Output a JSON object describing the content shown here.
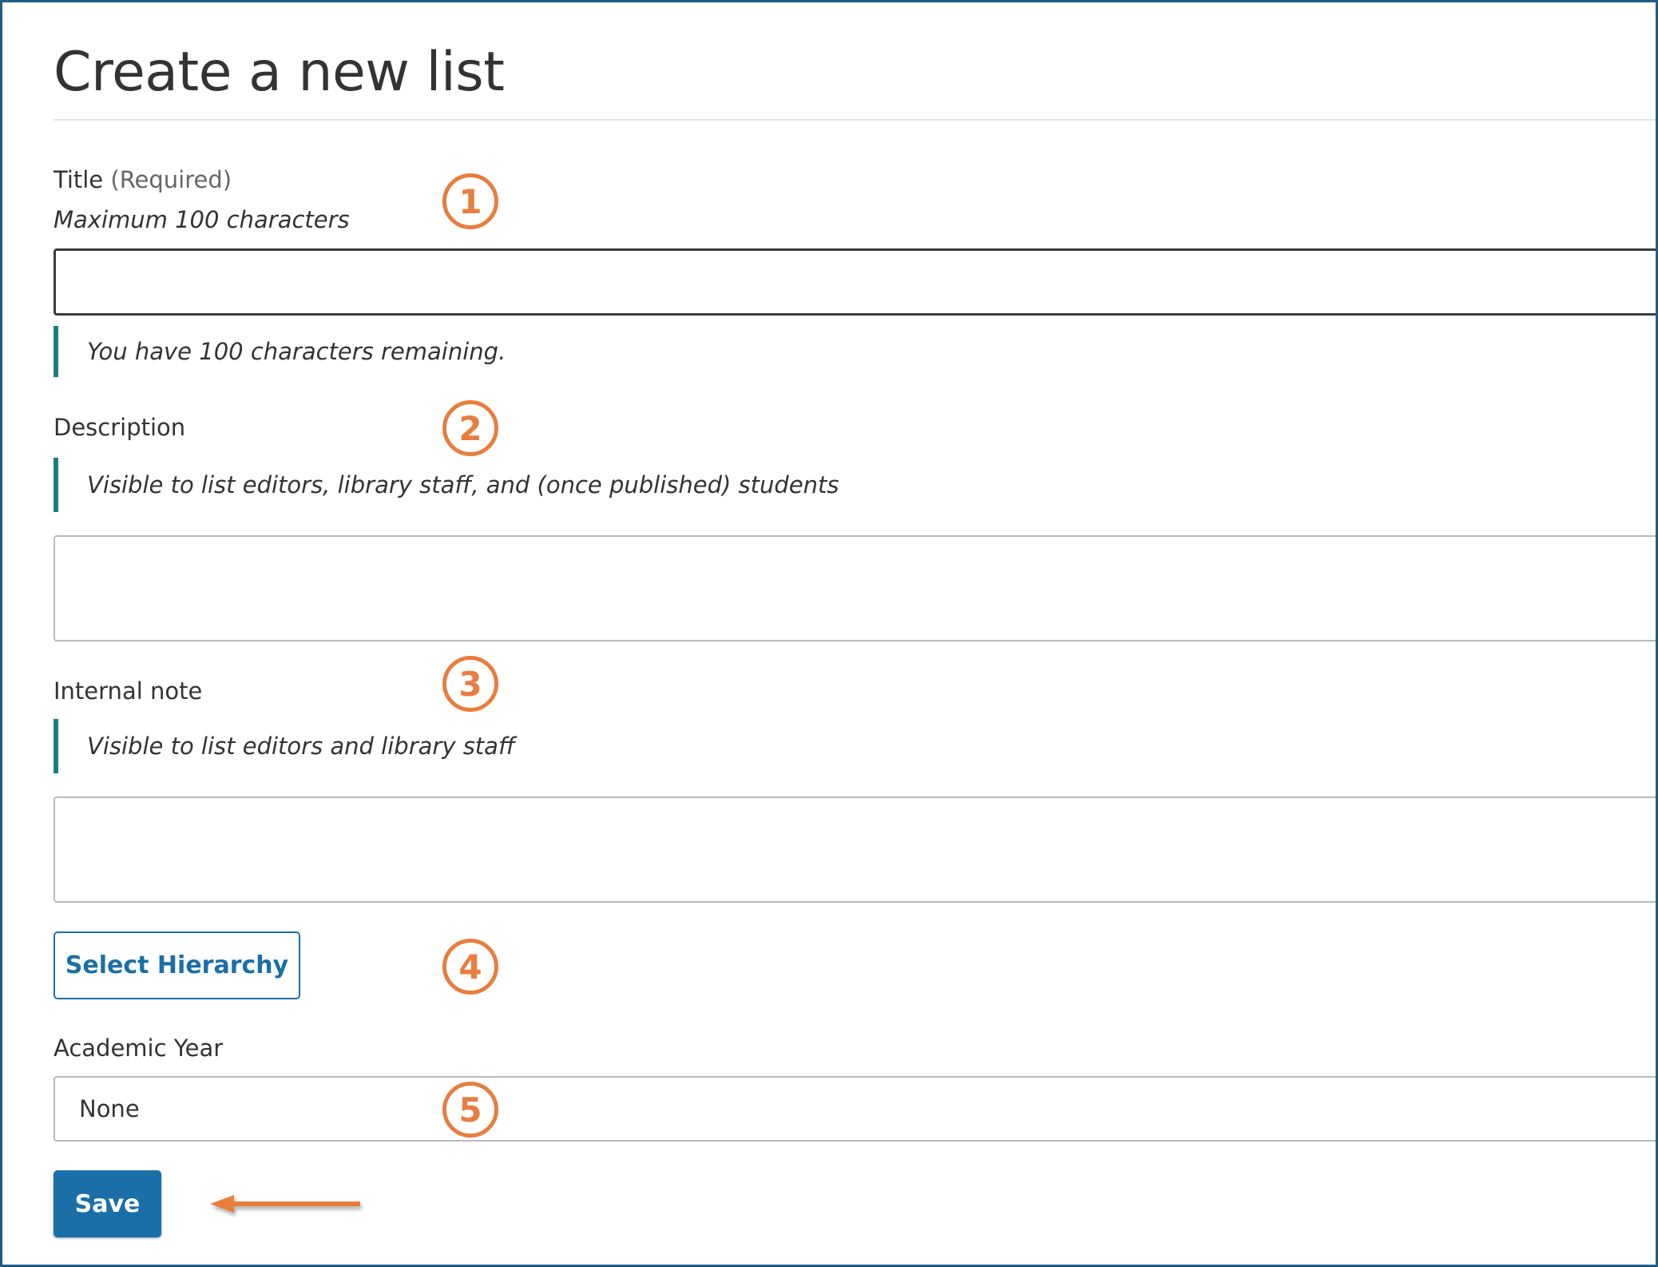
{
  "page": {
    "title": "Create a new list"
  },
  "title_field": {
    "label": "Title",
    "required": "(Required)",
    "hint": "Maximum 100 characters",
    "value": "",
    "remaining": "You have 100 characters remaining."
  },
  "description_field": {
    "label": "Description",
    "note": "Visible to list editors, library staff, and (once published) students",
    "value": ""
  },
  "internal_note_field": {
    "label": "Internal note",
    "note": "Visible to list editors and library staff",
    "value": ""
  },
  "hierarchy": {
    "button_label": "Select Hierarchy"
  },
  "academic_year": {
    "label": "Academic Year",
    "selected": "None"
  },
  "save": {
    "label": "Save"
  },
  "markers": [
    "1",
    "2",
    "3",
    "4",
    "5"
  ],
  "colors": {
    "accent_blue": "#1a6fa8",
    "callout_orange": "#e87d3e",
    "note_teal": "#1e7d80",
    "frame_border": "#1f5f86"
  },
  "icons": {
    "save_pointer": "arrow-left-icon"
  }
}
